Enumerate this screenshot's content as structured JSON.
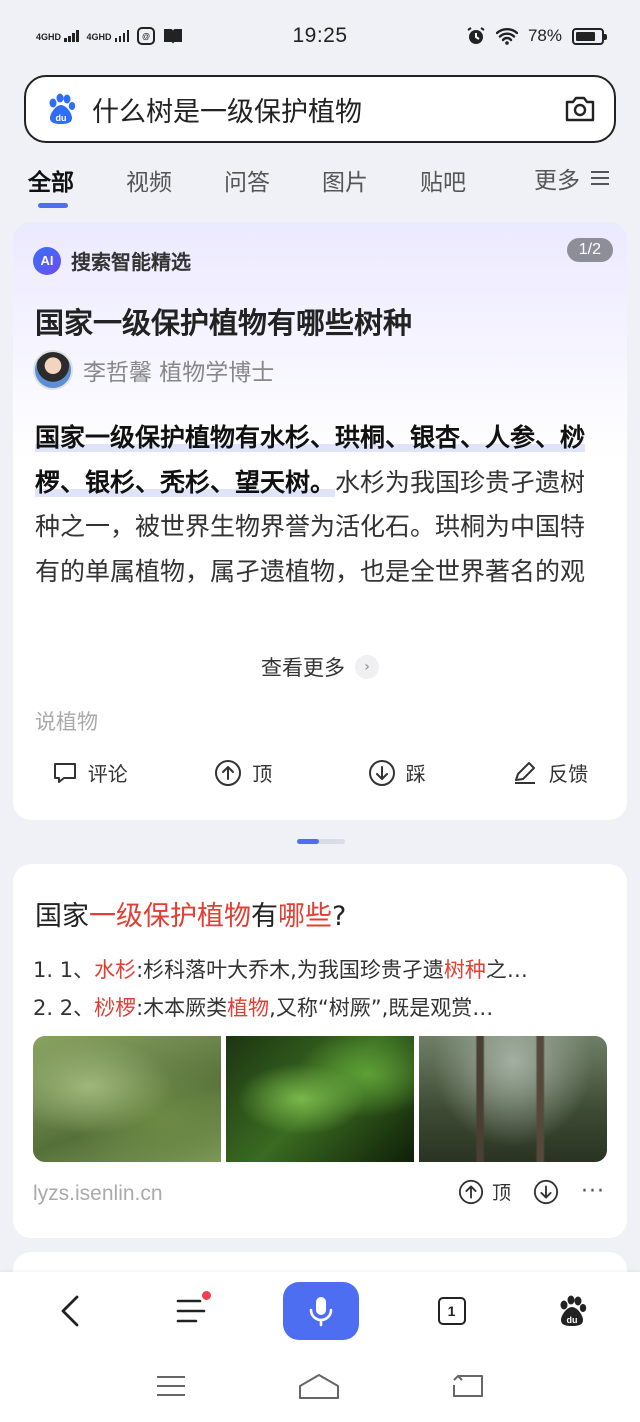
{
  "status_bar": {
    "sim1": "4GHD",
    "sim2": "4GHD",
    "app_icon_text": "@",
    "time": "19:25",
    "battery": "78%",
    "battery_level": 0.78
  },
  "search": {
    "query": "什么树是一级保护植物"
  },
  "tabs": [
    "全部",
    "视频",
    "问答",
    "图片",
    "贴吧"
  ],
  "tab_more": "更多",
  "ai_card": {
    "header": "搜索智能精选",
    "page_indicator": "1/2",
    "title": "国家一级保护植物有哪些树种",
    "author": "李哲馨 植物学博士",
    "body_bold": "国家一级保护植物有水杉、珙桐、银杏、人参、桫椤、银杉、秃杉、望天树。",
    "body_rest": "水杉为我国珍贵孑遗树种之一，被世界生物界誉为活化石。珙桐为中国特有的单属植物，属孑遗植物，也是全世界著名的观赏植物。人参被人…",
    "see_more": "查看更多",
    "source": "说植物",
    "actions": {
      "comment": "评论",
      "up": "顶",
      "down": "踩",
      "feedback": "反馈"
    }
  },
  "result_card": {
    "title_parts": [
      "国家",
      "一级保护植物",
      "有",
      "哪些",
      "?"
    ],
    "line1": {
      "num": "1. 1、",
      "term": "水杉",
      "text": ":杉科落叶大乔木,为我国珍贵孑遗",
      "term2": "树种",
      "tail": "之…"
    },
    "line2": {
      "num": "2. 2、",
      "term": "桫椤",
      "text": ":木本厥类",
      "term2": "植物",
      "tail": ",又称“树厥”,既是观赏…"
    },
    "source": "lyzs.isenlin.cn",
    "up_label": "顶"
  },
  "colors": {
    "accent": "#4e6ef2",
    "highlight": "#e33e33",
    "badge": "#8e8e99"
  },
  "icons": [
    "baidu-paw-icon",
    "camera-icon",
    "menu-icon",
    "ai-logo-icon",
    "comment-icon",
    "thumb-up-icon",
    "thumb-down-icon",
    "pen-icon",
    "back-icon",
    "feed-icon",
    "mic-icon",
    "tabs-icon",
    "home-icon",
    "system-back-icon"
  ],
  "bottom_nav": {
    "tabs_count": "1"
  }
}
